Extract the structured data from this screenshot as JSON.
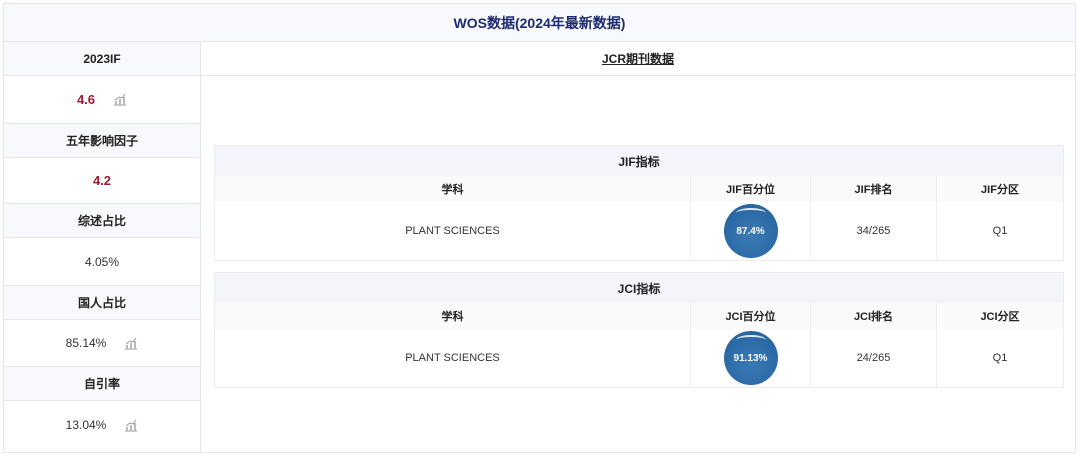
{
  "header": {
    "title": "WOS数据(2024年最新数据)"
  },
  "metrics": [
    {
      "label": "2023IF",
      "value": "4.6",
      "trend": true
    },
    {
      "label": "五年影响因子",
      "value": "4.2",
      "trend": false
    },
    {
      "label": "综述占比",
      "value": "4.05%",
      "trend": false
    },
    {
      "label": "国人占比",
      "value": "85.14%",
      "trend": true
    },
    {
      "label": "自引率",
      "value": "13.04%",
      "trend": true
    }
  ],
  "jcr": {
    "title": "JCR期刊数据"
  },
  "jif": {
    "title": "JIF指标",
    "headers": [
      "学科",
      "JIF百分位",
      "JIF排名",
      "JIF分区"
    ],
    "row": {
      "subject": "PLANT SCIENCES",
      "percentile": "87.4%",
      "rank": "34/265",
      "quartile": "Q1"
    }
  },
  "jci": {
    "title": "JCI指标",
    "headers": [
      "学科",
      "JCI百分位",
      "JCI排名",
      "JCI分区"
    ],
    "row": {
      "subject": "PLANT SCIENCES",
      "percentile": "91.13%",
      "rank": "24/265",
      "quartile": "Q1"
    }
  },
  "icons": {
    "trend": "trend-chart-icon"
  },
  "colors": {
    "header_text": "#1e2a6e",
    "highlight_value": "#a01830",
    "ball": "#2b6aa6"
  }
}
